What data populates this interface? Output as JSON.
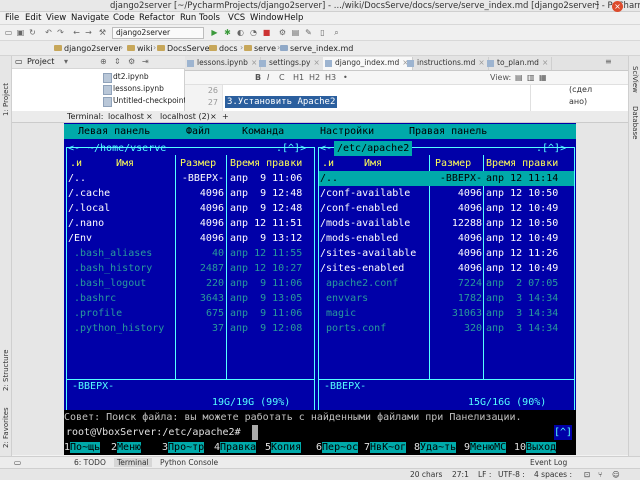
{
  "window": {
    "title": "django2server [~/PycharmProjects/django2server] - .../wiki/DocsServe/docs/serve/serve_index.md [django2server] - PyCharm",
    "minimize": "–",
    "close": "×"
  },
  "menu": [
    "File",
    "Edit",
    "View",
    "Navigate",
    "Code",
    "Refactor",
    "Run",
    "Tools",
    "VCS",
    "Window",
    "Help"
  ],
  "toolbar": {
    "run_config": "django2server"
  },
  "breadcrumbs": [
    "django2server",
    "wiki",
    "DocsServe",
    "docs",
    "serve",
    "serve_index.md"
  ],
  "project": {
    "label": "Project",
    "files": [
      "dt2.ipynb",
      "lessons.ipynb",
      "Untitled-checkpoint.ipy"
    ]
  },
  "editor": {
    "tabs": [
      "lessons.ipynb",
      "settings.py",
      "django_index.md",
      "instructions.md",
      "to_plan.md"
    ],
    "line_numbers": [
      "26",
      "27"
    ],
    "current_line": "3.Установить Apache2",
    "view_label": "View:",
    "preview": [
      "(сдел",
      "ано)"
    ],
    "md_buttons": [
      "B",
      "I",
      "C",
      "H1",
      "H2",
      "H3",
      "•"
    ]
  },
  "side_tabs": {
    "left": [
      "1: Project",
      "2: Structure",
      "2: Favorites"
    ],
    "right": [
      "SciView",
      "Database"
    ]
  },
  "terminal": {
    "label": "Terminal:",
    "tabs": [
      "localhost",
      "localhost (2)"
    ],
    "add": "+",
    "mc_menu": [
      "Левая панель",
      "Файл",
      "Команда",
      "Настройки",
      "Правая панель"
    ],
    "left": {
      "path": "~/home/vserve",
      "corner": ".[^]>",
      "cols": {
        "n": ".и",
        "name": "Имя",
        "size": "Размер",
        "time": "Время правки"
      },
      "rows": [
        {
          "name": "/..",
          "size": "-BBEPX-",
          "time": "апр  9 11:06",
          "kind": "dir"
        },
        {
          "name": "/.cache",
          "size": "4096",
          "time": "апр  9 12:48",
          "kind": "dir"
        },
        {
          "name": "/.local",
          "size": "4096",
          "time": "апр  9 12:48",
          "kind": "dir"
        },
        {
          "name": "/.nano",
          "size": "4096",
          "time": "апр 12 11:51",
          "kind": "dir"
        },
        {
          "name": "/Env",
          "size": "4096",
          "time": "апр  9 13:12",
          "kind": "dir"
        },
        {
          "name": " .bash_aliases",
          "size": "40",
          "time": "апр 12 11:55",
          "kind": "hid"
        },
        {
          "name": " .bash_history",
          "size": "2487",
          "time": "апр 12 10:27",
          "kind": "hid"
        },
        {
          "name": " .bash_logout",
          "size": "220",
          "time": "апр  9 11:06",
          "kind": "hid"
        },
        {
          "name": " .bashrc",
          "size": "3643",
          "time": "апр  9 13:05",
          "kind": "hid"
        },
        {
          "name": " .profile",
          "size": "675",
          "time": "апр  9 11:06",
          "kind": "hid"
        },
        {
          "name": " .python_history",
          "size": "37",
          "time": "апр  9 12:08",
          "kind": "hid"
        }
      ],
      "status": "-BBEPX-",
      "summary": "19G/19G (99%)"
    },
    "right": {
      "path": "/etc/apache2",
      "corner": ".[^]>",
      "cols": {
        "n": ".и",
        "name": "Имя",
        "size": "Размер",
        "time": "Время правки"
      },
      "rows": [
        {
          "name": "/..",
          "size": "-BBEPX-",
          "time": "апр 12 11:14",
          "kind": "cur"
        },
        {
          "name": "/conf-available",
          "size": "4096",
          "time": "апр 12 10:50",
          "kind": "dir"
        },
        {
          "name": "/conf-enabled",
          "size": "4096",
          "time": "апр 12 10:49",
          "kind": "dir"
        },
        {
          "name": "/mods-available",
          "size": "12288",
          "time": "апр 12 10:50",
          "kind": "dir"
        },
        {
          "name": "/mods-enabled",
          "size": "4096",
          "time": "апр 12 10:49",
          "kind": "dir"
        },
        {
          "name": "/sites-available",
          "size": "4096",
          "time": "апр 12 11:26",
          "kind": "dir"
        },
        {
          "name": "/sites-enabled",
          "size": "4096",
          "time": "апр 12 10:49",
          "kind": "dir"
        },
        {
          "name": " apache2.conf",
          "size": "7224",
          "time": "апр  2 07:05",
          "kind": "hid"
        },
        {
          "name": " envvars",
          "size": "1782",
          "time": "апр  3 14:34",
          "kind": "hid"
        },
        {
          "name": " magic",
          "size": "31063",
          "time": "апр  3 14:34",
          "kind": "hid"
        },
        {
          "name": " ports.conf",
          "size": "320",
          "time": "апр  3 14:34",
          "kind": "hid"
        }
      ],
      "status": "-BBEPX-",
      "summary": "15G/16G (90%)"
    },
    "hint": "Совет: Поиск файла: вы можете работать с найденными файлами при Панелизации.",
    "prompt": "root@VboxServer:/etc/apache2#",
    "prompt_corner": "[^]",
    "fkeys": [
      {
        "n": "1",
        "l": "По~щь"
      },
      {
        "n": "2",
        "l": "Меню"
      },
      {
        "n": "3",
        "l": "Про~тр"
      },
      {
        "n": "4",
        "l": "Правка"
      },
      {
        "n": "5",
        "l": "Копия"
      },
      {
        "n": "6",
        "l": "Пер~ос"
      },
      {
        "n": "7",
        "l": "НвК~ог"
      },
      {
        "n": "8",
        "l": "Уда~ть"
      },
      {
        "n": "9",
        "l": "МенюМС"
      },
      {
        "n": "10",
        "l": "Выход"
      }
    ]
  },
  "bottom_tools": [
    "6: TODO",
    "Terminal",
    "Python Console",
    "Event Log"
  ],
  "status": [
    "20 chars",
    "27:1",
    "LF :",
    "UTF-8 :",
    "4 spaces :"
  ],
  "colors": {
    "mc_blue": "#0000a8",
    "mc_cyan": "#55ffff",
    "mc_bar": "#00aaaa",
    "editor_sel": "#2b5f9e"
  }
}
